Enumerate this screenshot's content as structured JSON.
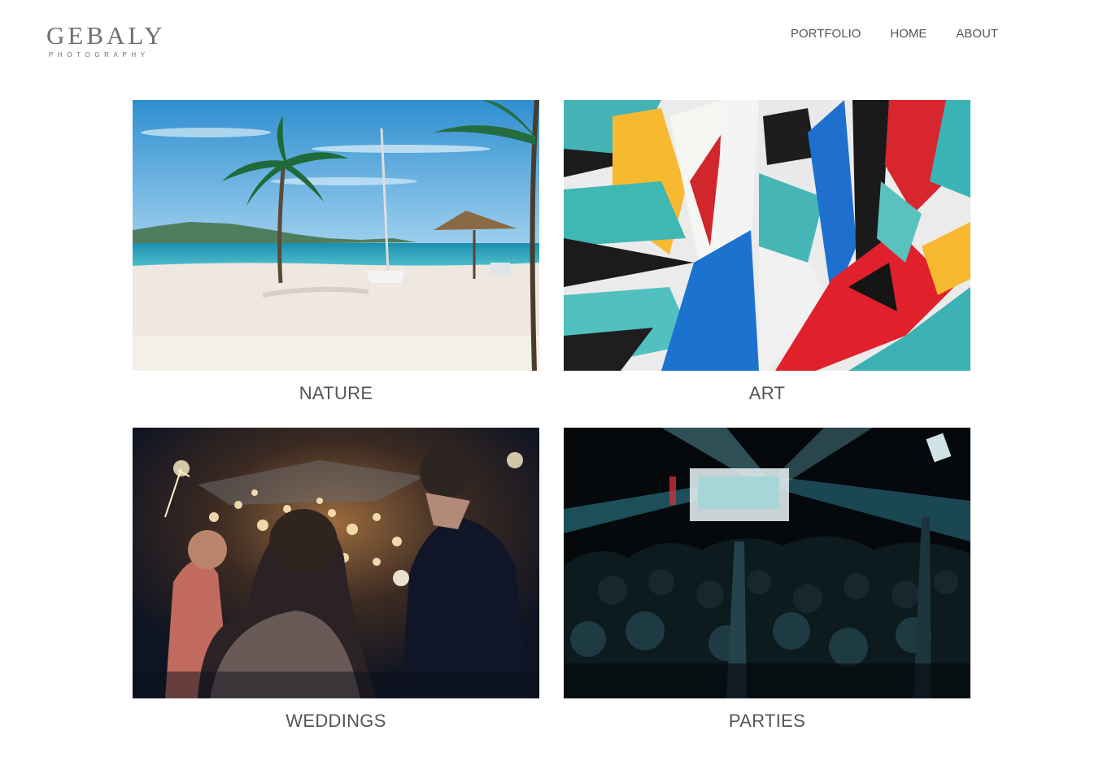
{
  "logo": {
    "name": "GEBALY",
    "tagline": "PHOTOGRAPHY"
  },
  "nav": {
    "items": [
      "PORTFOLIO",
      "HOME",
      "ABOUT"
    ]
  },
  "gallery": {
    "cards": [
      {
        "label": "NATURE"
      },
      {
        "label": "ART"
      },
      {
        "label": "WEDDINGS"
      },
      {
        "label": "PARTIES"
      }
    ]
  },
  "colors": {
    "text": "#555555",
    "logo": "#6f6f6f",
    "background": "#ffffff"
  }
}
